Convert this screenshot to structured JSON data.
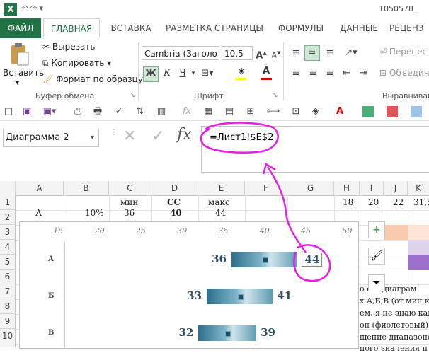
{
  "window": {
    "title_fragment": "1050578_"
  },
  "tabs": [
    {
      "label": "ФАЙЛ"
    },
    {
      "label": "ГЛАВНАЯ"
    },
    {
      "label": "ВСТАВКА"
    },
    {
      "label": "РАЗМЕТКА СТРАНИЦЫ"
    },
    {
      "label": "ФОРМУЛЫ"
    },
    {
      "label": "ДАННЫЕ"
    },
    {
      "label": "РЕЦЕНЗ"
    }
  ],
  "clipboard": {
    "paste_label": "Вставить",
    "cut_label": "Вырезать",
    "copy_label": "Копировать",
    "format_painter_label": "Формат по образцу",
    "group_label": "Буфер обмена"
  },
  "font": {
    "family_value": "Cambria (Заголо",
    "size_value": "10,5",
    "bold": "Ж",
    "italic": "К",
    "underline": "Ч",
    "grow": "A",
    "shrink": "A",
    "group_label": "Шрифт"
  },
  "alignment": {
    "wrap_label": "Перенест",
    "merge_label": "Объедин",
    "group_label": "Выравнивани"
  },
  "formula_bar": {
    "name_box": "Диаграмма 2",
    "cancel": "✕",
    "enter": "✓",
    "fx": "fx",
    "formula": "=Лист1!$E$2"
  },
  "columns": [
    "A",
    "B",
    "C",
    "D",
    "E",
    "F",
    "G",
    "H",
    "I",
    "J",
    "K"
  ],
  "rows": [
    "1",
    "2",
    "3",
    "4",
    "5",
    "6",
    "7",
    "8",
    "9",
    "10"
  ],
  "cells": {
    "c1": "мин",
    "d1": "СС",
    "e1": "макс",
    "h1": "18",
    "i1": "20",
    "j1": "22",
    "k1": "31,5",
    "a2": "А",
    "b2": "10%",
    "c2": "36",
    "d2": "40",
    "e2": "44"
  },
  "chart_data": {
    "type": "bar",
    "orientation": "horizontal-floating",
    "x_ticks": [
      15,
      20,
      25,
      30,
      35,
      40,
      45,
      50
    ],
    "xlim": [
      10,
      51
    ],
    "categories": [
      "А",
      "Б",
      "В"
    ],
    "series": [
      {
        "values_min": [
          36,
          33,
          32
        ],
        "values_max": [
          44,
          41,
          39
        ]
      }
    ],
    "labels": {
      "min": [
        "36",
        "33",
        "32"
      ],
      "max": [
        "44",
        "41",
        "39"
      ]
    }
  },
  "side_buttons": {
    "add": "+",
    "style": "brush-icon",
    "filter": "filter-icon"
  },
  "doc_text": [
    "о сть диаграм",
    "х А,Б,В (от мин к м",
    "ем, я не знаю как",
    "он (фиолетовый)",
    "щение диапазоно",
    "пого значения п"
  ],
  "colors": {
    "excel_green": "#217346",
    "bar": "#4f8fa9",
    "annotation": "#e61fe6",
    "label": "#2e4d60"
  }
}
